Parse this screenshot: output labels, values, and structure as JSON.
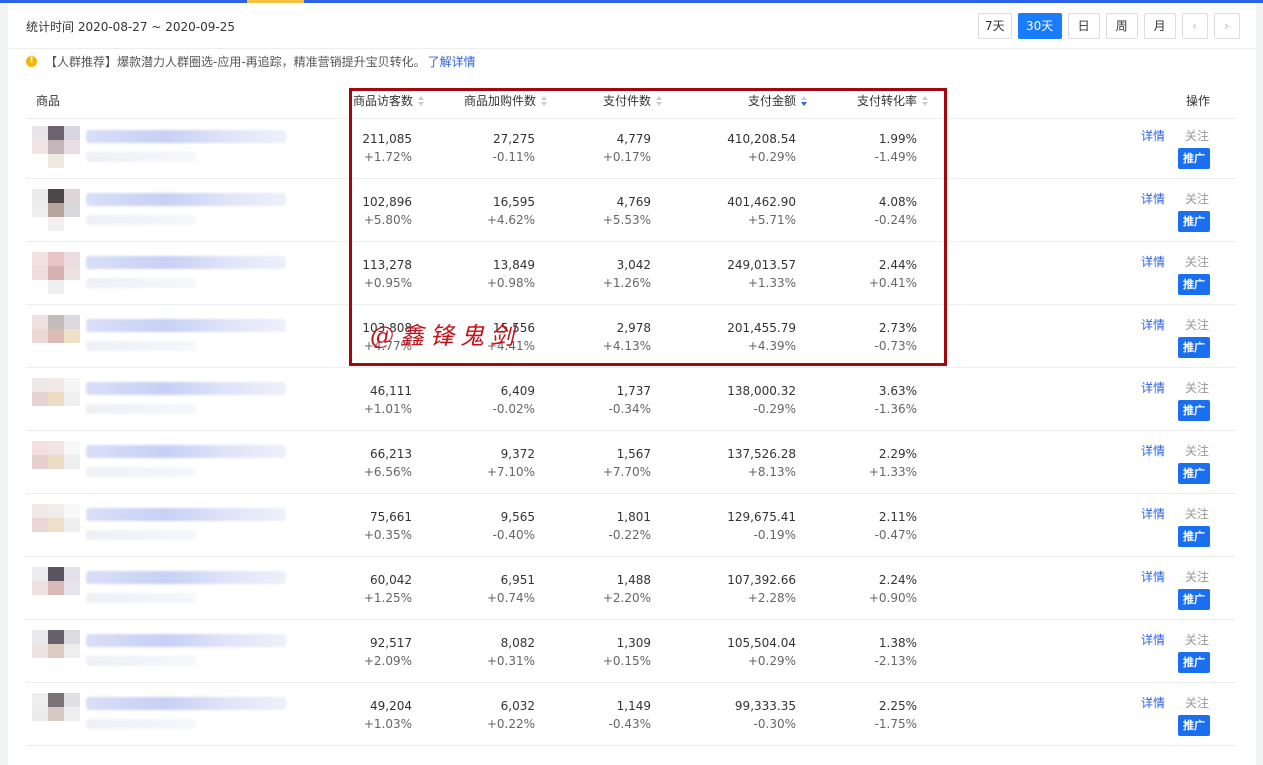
{
  "toolbar": {
    "stat_time": "统计时间 2020-08-27 ~ 2020-09-25",
    "range_buttons": [
      "7天",
      "30天",
      "日",
      "周",
      "月"
    ],
    "active_range": "30天",
    "prev_icon": "‹",
    "next_icon": "›"
  },
  "tip": {
    "icon": "!",
    "text": "【人群推荐】爆款潜力人群圈选-应用-再追踪，精准营销提升宝贝转化。",
    "link": "了解详情"
  },
  "table": {
    "headers": {
      "product": "商品",
      "visitors": "商品访客数",
      "cart": "商品加购件数",
      "paid_items": "支付件数",
      "paid_amount": "支付金额",
      "conversion": "支付转化率",
      "actions": "操作"
    },
    "sorted_column": "支付金额",
    "action_labels": {
      "detail": "详情",
      "follow": "关注",
      "promote": "推广"
    },
    "rows": [
      {
        "visitors": "211,085",
        "visitors_d": "+1.72%",
        "cart": "27,275",
        "cart_d": "-0.11%",
        "paid_items": "4,779",
        "paid_items_d": "+0.17%",
        "paid_amount": "410,208.54",
        "paid_amount_d": "+0.29%",
        "conversion": "1.99%",
        "conversion_d": "-1.49%"
      },
      {
        "visitors": "102,896",
        "visitors_d": "+5.80%",
        "cart": "16,595",
        "cart_d": "+4.62%",
        "paid_items": "4,769",
        "paid_items_d": "+5.53%",
        "paid_amount": "401,462.90",
        "paid_amount_d": "+5.71%",
        "conversion": "4.08%",
        "conversion_d": "-0.24%"
      },
      {
        "visitors": "113,278",
        "visitors_d": "+0.95%",
        "cart": "13,849",
        "cart_d": "+0.98%",
        "paid_items": "3,042",
        "paid_items_d": "+1.26%",
        "paid_amount": "249,013.57",
        "paid_amount_d": "+1.33%",
        "conversion": "2.44%",
        "conversion_d": "+0.41%"
      },
      {
        "visitors": "103,808",
        "visitors_d": "+4.77%",
        "cart": "15,556",
        "cart_d": "+4.41%",
        "paid_items": "2,978",
        "paid_items_d": "+4.13%",
        "paid_amount": "201,455.79",
        "paid_amount_d": "+4.39%",
        "conversion": "2.73%",
        "conversion_d": "-0.73%"
      },
      {
        "visitors": "46,111",
        "visitors_d": "+1.01%",
        "cart": "6,409",
        "cart_d": "-0.02%",
        "paid_items": "1,737",
        "paid_items_d": "-0.34%",
        "paid_amount": "138,000.32",
        "paid_amount_d": "-0.29%",
        "conversion": "3.63%",
        "conversion_d": "-1.36%"
      },
      {
        "visitors": "66,213",
        "visitors_d": "+6.56%",
        "cart": "9,372",
        "cart_d": "+7.10%",
        "paid_items": "1,567",
        "paid_items_d": "+7.70%",
        "paid_amount": "137,526.28",
        "paid_amount_d": "+8.13%",
        "conversion": "2.29%",
        "conversion_d": "+1.33%"
      },
      {
        "visitors": "75,661",
        "visitors_d": "+0.35%",
        "cart": "9,565",
        "cart_d": "-0.40%",
        "paid_items": "1,801",
        "paid_items_d": "-0.22%",
        "paid_amount": "129,675.41",
        "paid_amount_d": "-0.19%",
        "conversion": "2.11%",
        "conversion_d": "-0.47%"
      },
      {
        "visitors": "60,042",
        "visitors_d": "+1.25%",
        "cart": "6,951",
        "cart_d": "+0.74%",
        "paid_items": "1,488",
        "paid_items_d": "+2.20%",
        "paid_amount": "107,392.66",
        "paid_amount_d": "+2.28%",
        "conversion": "2.24%",
        "conversion_d": "+0.90%"
      },
      {
        "visitors": "92,517",
        "visitors_d": "+2.09%",
        "cart": "8,082",
        "cart_d": "+0.31%",
        "paid_items": "1,309",
        "paid_items_d": "+0.15%",
        "paid_amount": "105,504.04",
        "paid_amount_d": "+0.29%",
        "conversion": "1.38%",
        "conversion_d": "-2.13%"
      },
      {
        "visitors": "49,204",
        "visitors_d": "+1.03%",
        "cart": "6,032",
        "cart_d": "+0.22%",
        "paid_items": "1,149",
        "paid_items_d": "-0.43%",
        "paid_amount": "99,333.35",
        "paid_amount_d": "-0.30%",
        "conversion": "2.25%",
        "conversion_d": "-1.75%"
      }
    ]
  },
  "watermark": "@鑫锋鬼剑",
  "colors": {
    "accent": "#1a7cf8",
    "highlight_box": "#a4080c",
    "link": "#2d62e6"
  }
}
